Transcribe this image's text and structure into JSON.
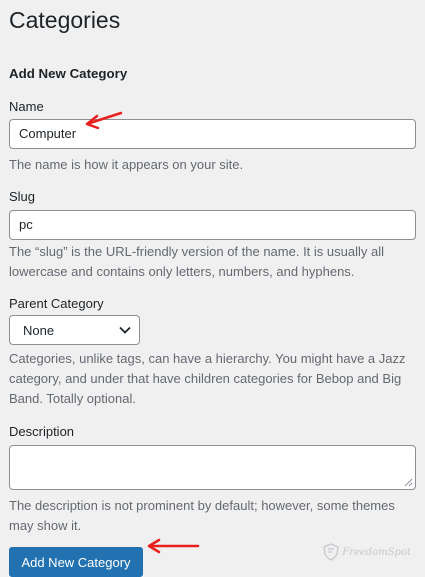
{
  "page": {
    "title": "Categories"
  },
  "form": {
    "heading": "Add New Category",
    "name": {
      "label": "Name",
      "value": "Computer",
      "help": "The name is how it appears on your site."
    },
    "slug": {
      "label": "Slug",
      "value": "pc",
      "help": "The “slug” is the URL-friendly version of the name. It is usually all lowercase and contains only letters, numbers, and hyphens."
    },
    "parent": {
      "label": "Parent Category",
      "selected": "None",
      "help": "Categories, unlike tags, can have a hierarchy. You might have a Jazz category, and under that have children categories for Bebop and Big Band. Totally optional."
    },
    "description": {
      "label": "Description",
      "value": "",
      "help": "The description is not prominent by default; however, some themes may show it."
    },
    "submit_label": "Add New Category"
  },
  "annotation_color": "#e8211e",
  "accent_color": "#2271b1",
  "watermark": {
    "text": "FreedomSpot"
  }
}
